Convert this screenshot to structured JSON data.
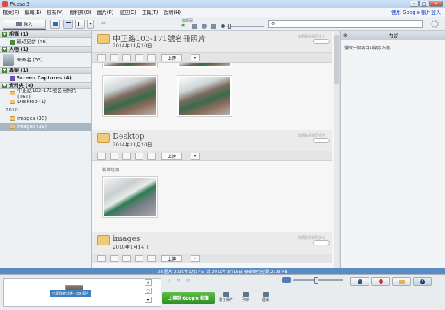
{
  "window": {
    "title": "Picasa 3"
  },
  "menu": {
    "items": [
      "檔案(F)",
      "編輯(E)",
      "檢視(V)",
      "資料夾(O)",
      "圖片(P)",
      "建立(C)",
      "工具(T)",
      "說明(H)"
    ],
    "signin": "使用 Google 帳戶登入"
  },
  "toolbar": {
    "import_label": "匯入",
    "filter_label": "篩選器",
    "search_placeholder": ""
  },
  "left_panel": {
    "sections": [
      {
        "title": "相簿 (1)",
        "rows": [
          "最近更新 (46)"
        ]
      },
      {
        "title": "人物 (1)",
        "rows": [
          "未命名 (53)"
        ]
      },
      {
        "title": "專案 (1)",
        "rows": [
          "Screen Captures (4)"
        ]
      },
      {
        "title": "資料夾 (4)",
        "rows": [
          "中正路103-171號名冊照片 (161)",
          "Desktop (1)"
        ]
      }
    ],
    "year": "2010",
    "year_rows": [
      "images (38)",
      "images (38)"
    ]
  },
  "folders": [
    {
      "title": "中正路103-171號名冊照片",
      "date": "2014年11月10日",
      "meta": "與網路相簿同步化"
    },
    {
      "title": "Desktop",
      "date": "2014年11月10日",
      "meta": "與網路相簿同步化",
      "caption": "新增說明"
    },
    {
      "title": "images",
      "date": "2010年1月14日",
      "meta": "與網路相簿同步化"
    }
  ],
  "share_label": "上傳",
  "right_panel": {
    "title": "內容",
    "hint": "選取一個項目以顯示內容。"
  },
  "status": {
    "text": "38 圖片   2010年1月14日 到 2011年9月15日   硬碟使用空間 27.8 MB"
  },
  "bottom": {
    "tray_label": "已選取資料夾 - 38 相片",
    "upload_label": "上傳到 Google 相簿",
    "actions": [
      "電子郵件",
      "列印",
      "匯出"
    ]
  },
  "colors": {
    "statusbar": "#5a8bc4",
    "upload": "#3a9a2c",
    "accent": "#49833a"
  }
}
